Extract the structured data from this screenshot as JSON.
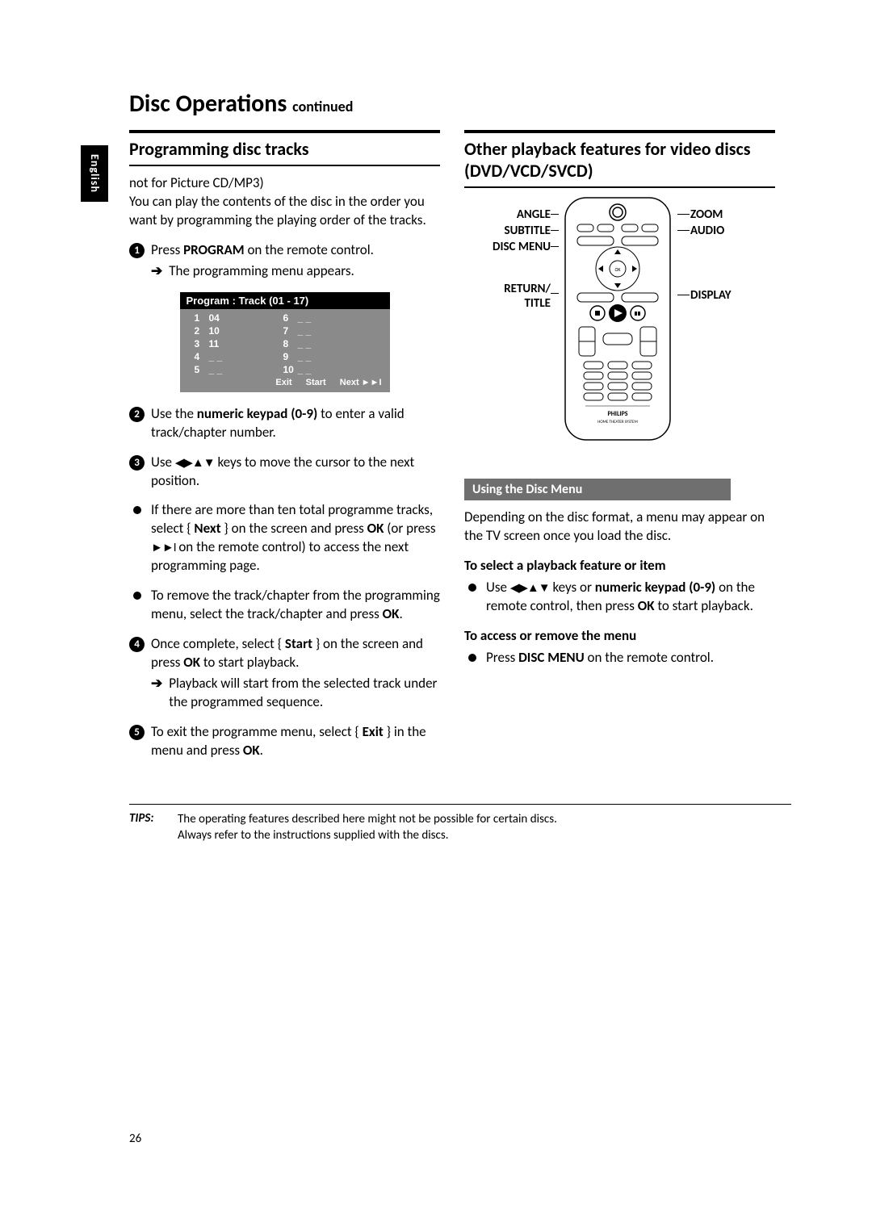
{
  "lang_tab": "English",
  "page_title": "Disc Operations",
  "page_title_suffix": "continued",
  "left": {
    "heading": "Programming disc tracks",
    "note": "not for Picture CD/MP3)",
    "intro": "You can play the contents of the disc in the order you want by programming the playing order of the tracks.",
    "step1a": "Press ",
    "step1b": "PROGRAM",
    "step1c": " on the remote control.",
    "step1_result": "The programming menu appears.",
    "prog": {
      "header": "Program : Track (01 - 17)",
      "left_rows": [
        {
          "n": "1",
          "v": "04"
        },
        {
          "n": "2",
          "v": "10"
        },
        {
          "n": "3",
          "v": "11"
        },
        {
          "n": "4",
          "v": "_ _"
        },
        {
          "n": "5",
          "v": "_ _"
        }
      ],
      "right_rows": [
        {
          "n": "6",
          "v": "_ _"
        },
        {
          "n": "7",
          "v": "_ _"
        },
        {
          "n": "8",
          "v": "_ _"
        },
        {
          "n": "9",
          "v": "_ _"
        },
        {
          "n": "10",
          "v": "_ _"
        }
      ],
      "footer_exit": "Exit",
      "footer_start": "Start",
      "footer_next": "Next ►►I"
    },
    "step2a": "Use the ",
    "step2b": "numeric keypad (0-9)",
    "step2c": " to enter a valid track/chapter number.",
    "step3a": "Use ",
    "step3b": "◀▶▲▼",
    "step3c": " keys to move the cursor to the next position.",
    "bullet1a": "If there are more than ten total programme tracks, select { ",
    "bullet1b": "Next",
    "bullet1c": " } on the screen and press ",
    "bullet1d": "OK",
    "bullet1e": " (or press ",
    "bullet1f": "►►I",
    "bullet1g": " on the remote control) to access the next programming page.",
    "bullet2a": "To remove the track/chapter from the programming menu, select the track/chapter and press ",
    "bullet2b": "OK",
    "bullet2c": ".",
    "step4a": "Once complete, select { ",
    "step4b": "Start",
    "step4c": " } on the screen and press ",
    "step4d": "OK",
    "step4e": " to start playback.",
    "step4_result": "Playback will start from the selected track under the programmed sequence.",
    "step5a": "To exit the programme menu, select { ",
    "step5b": "Exit",
    "step5c": " } in the menu and press ",
    "step5d": "OK",
    "step5e": "."
  },
  "right": {
    "heading": "Other playback features for video discs (DVD/VCD/SVCD)",
    "labels": {
      "angle": "ANGLE",
      "subtitle": "SUBTITLE",
      "disc_menu": "DISC MENU",
      "return": "RETURN/",
      "title": "TITLE",
      "zoom": "ZOOM",
      "audio": "AUDIO",
      "display": "DISPLAY"
    },
    "remote_brand": "PHILIPS",
    "remote_sub": "HOME THEATER SYSTEM",
    "sub_heading": "Using the Disc Menu",
    "para1": "Depending on the disc format, a menu may appear on the TV screen once you load the disc.",
    "sel_head": "To select a playback feature or item",
    "sel_a": "Use ",
    "sel_b": "◀▶▲▼",
    "sel_c": " keys or ",
    "sel_d": "numeric keypad (0-9)",
    "sel_e": " on the remote control, then press ",
    "sel_f": "OK",
    "sel_g": " to start playback.",
    "acc_head": "To access or remove the menu",
    "acc_a": "Press ",
    "acc_b": "DISC MENU",
    "acc_c": " on the remote control."
  },
  "tips": {
    "label": "TIPS:",
    "line1": "The operating features described here might not be possible for certain discs.",
    "line2": "Always refer to the instructions supplied with the discs."
  },
  "page_number": "26"
}
